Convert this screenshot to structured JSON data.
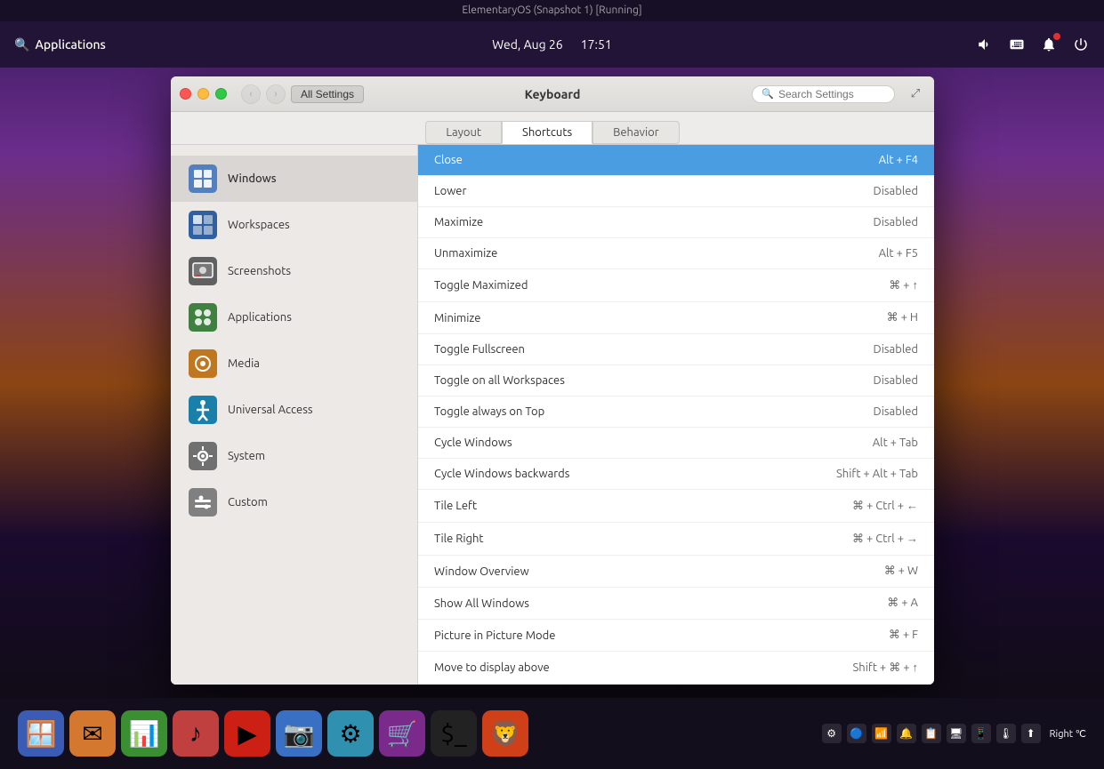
{
  "os_title": "ElementaryOS (Snapshot 1) [Running]",
  "topbar": {
    "apps_label": "Applications",
    "datetime": "Wed, Aug 26",
    "time": "17:51",
    "icons": [
      "volume",
      "keyboard",
      "notification",
      "power"
    ]
  },
  "dialog": {
    "title": "Keyboard",
    "nav_back_label": "‹",
    "all_settings_label": "All Settings",
    "search_placeholder": "Search Settings",
    "expand_icon": "⤢",
    "tabs": [
      {
        "id": "layout",
        "label": "Layout",
        "active": false
      },
      {
        "id": "shortcuts",
        "label": "Shortcuts",
        "active": true
      },
      {
        "id": "behavior",
        "label": "Behavior",
        "active": false
      }
    ],
    "sidebar_items": [
      {
        "id": "windows",
        "label": "Windows",
        "active": true
      },
      {
        "id": "workspaces",
        "label": "Workspaces",
        "active": false
      },
      {
        "id": "screenshots",
        "label": "Screenshots",
        "active": false
      },
      {
        "id": "applications",
        "label": "Applications",
        "active": false
      },
      {
        "id": "media",
        "label": "Media",
        "active": false
      },
      {
        "id": "universal-access",
        "label": "Universal Access",
        "active": false
      },
      {
        "id": "system",
        "label": "System",
        "active": false
      },
      {
        "id": "custom",
        "label": "Custom",
        "active": false
      }
    ],
    "shortcuts": [
      {
        "id": "close",
        "label": "Close",
        "key": "Alt + F4",
        "selected": true
      },
      {
        "id": "lower",
        "label": "Lower",
        "key": "Disabled",
        "selected": false
      },
      {
        "id": "maximize",
        "label": "Maximize",
        "key": "Disabled",
        "selected": false
      },
      {
        "id": "unmaximize",
        "label": "Unmaximize",
        "key": "Alt + F5",
        "selected": false
      },
      {
        "id": "toggle-maximized",
        "label": "Toggle Maximized",
        "key": "⌘ + ↑",
        "selected": false
      },
      {
        "id": "minimize",
        "label": "Minimize",
        "key": "⌘ + H",
        "selected": false
      },
      {
        "id": "toggle-fullscreen",
        "label": "Toggle Fullscreen",
        "key": "Disabled",
        "selected": false
      },
      {
        "id": "toggle-all-workspaces",
        "label": "Toggle on all Workspaces",
        "key": "Disabled",
        "selected": false
      },
      {
        "id": "toggle-always-on-top",
        "label": "Toggle always on Top",
        "key": "Disabled",
        "selected": false
      },
      {
        "id": "cycle-windows",
        "label": "Cycle Windows",
        "key": "Alt + Tab",
        "selected": false
      },
      {
        "id": "cycle-windows-backwards",
        "label": "Cycle Windows backwards",
        "key": "Shift + Alt + Tab",
        "selected": false
      },
      {
        "id": "tile-left",
        "label": "Tile Left",
        "key": "⌘ + Ctrl + ←",
        "selected": false
      },
      {
        "id": "tile-right",
        "label": "Tile Right",
        "key": "⌘ + Ctrl + →",
        "selected": false
      },
      {
        "id": "window-overview",
        "label": "Window Overview",
        "key": "⌘ + W",
        "selected": false
      },
      {
        "id": "show-all-windows",
        "label": "Show All Windows",
        "key": "⌘ + A",
        "selected": false
      },
      {
        "id": "picture-in-picture",
        "label": "Picture in Picture Mode",
        "key": "⌘ + F",
        "selected": false
      },
      {
        "id": "move-display-above",
        "label": "Move to display above",
        "key": "Shift + ⌘ + ↑",
        "selected": false
      }
    ]
  },
  "taskbar": {
    "apps": [
      {
        "id": "multitasking",
        "icon": "🪟",
        "bg": "#3a6bc4"
      },
      {
        "id": "mail",
        "icon": "✉️",
        "bg": "#c4763a"
      },
      {
        "id": "files",
        "icon": "📊",
        "bg": "#3a8a3a"
      },
      {
        "id": "music",
        "icon": "🎵",
        "bg": "#c43a3a"
      },
      {
        "id": "youtube",
        "icon": "▶",
        "bg": "#c4201a"
      },
      {
        "id": "photos",
        "icon": "📷",
        "bg": "#4a7ac4"
      },
      {
        "id": "settings2",
        "icon": "⚙",
        "bg": "#4a9ab0"
      },
      {
        "id": "appstore",
        "icon": "🛍",
        "bg": "#8a3a8a"
      },
      {
        "id": "terminal",
        "icon": "$_",
        "bg": "#2a2a2a"
      },
      {
        "id": "browser",
        "icon": "🦁",
        "bg": "#d44a1a"
      }
    ],
    "right_text": "Right ℃"
  }
}
